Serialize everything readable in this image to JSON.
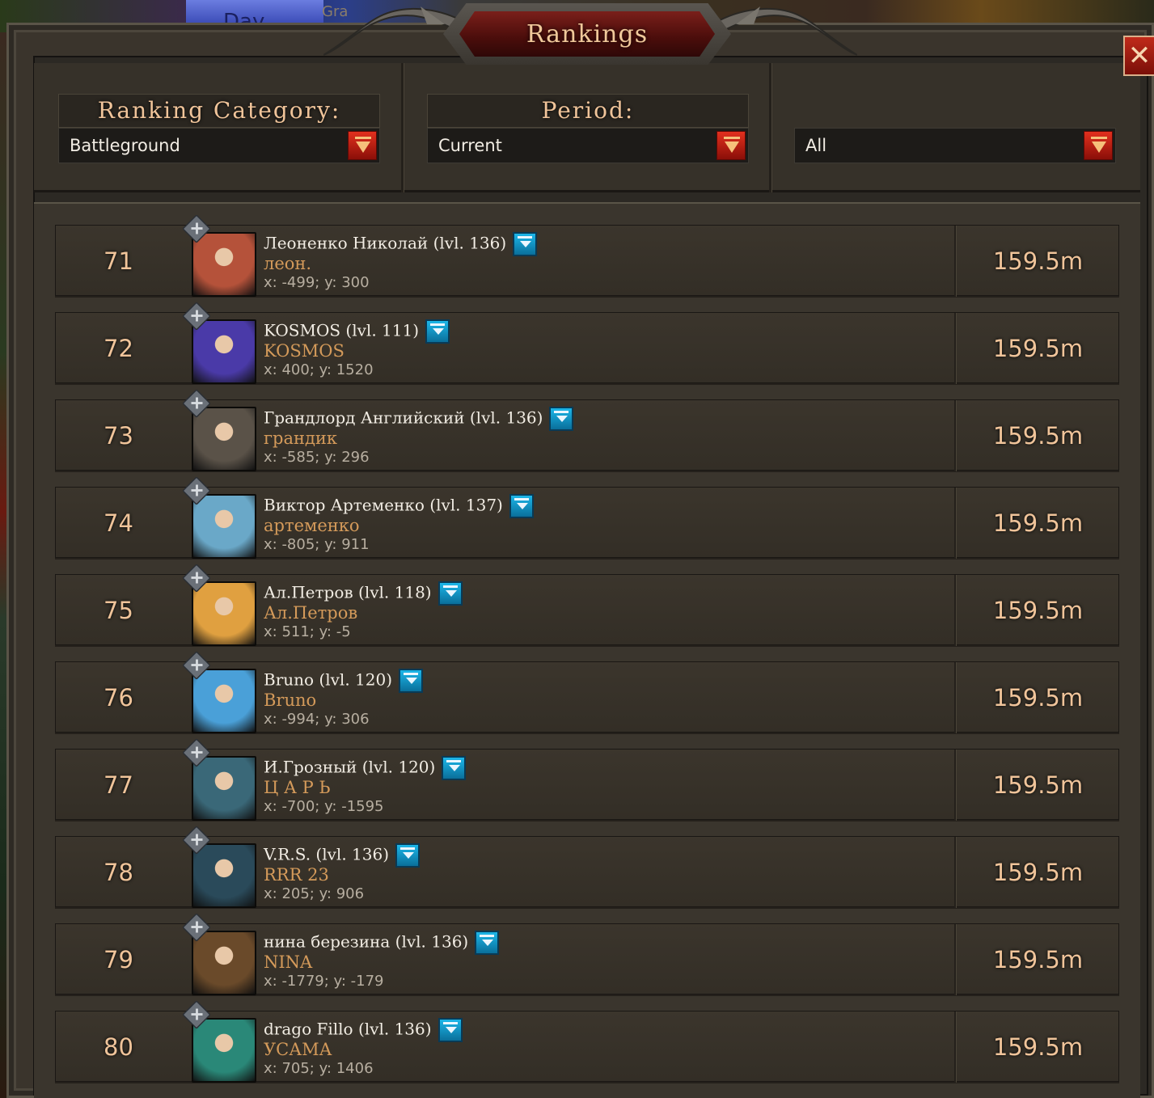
{
  "window": {
    "title": "Rankings",
    "close_icon": "close-icon"
  },
  "background": {
    "day_label": "Day",
    "partial_label": "Gra"
  },
  "filters": {
    "category": {
      "label": "Ranking Category:",
      "value": "Battleground"
    },
    "period": {
      "label": "Period:",
      "value": "Current"
    },
    "scope": {
      "value": "All"
    }
  },
  "colors": {
    "accent": "#f0c49a",
    "guild": "#d49a5a",
    "info_button": "#1cb6e8",
    "dropdown_button": "#e2301e"
  },
  "rows": [
    {
      "rank": "71",
      "name": "Леоненко Николай (lvl. 136)",
      "guild": "леон.",
      "coords": "x: -499; y: 300",
      "score": "159.5m",
      "avatar_color": "#b5523a"
    },
    {
      "rank": "72",
      "name": "KOSMOS (lvl. 111)",
      "guild": "KOSMOS",
      "coords": "x: 400; y: 1520",
      "score": "159.5m",
      "avatar_color": "#4a3aa8"
    },
    {
      "rank": "73",
      "name": "Грандлорд Английский (lvl. 136)",
      "guild": "грандик",
      "coords": "x: -585; y: 296",
      "score": "159.5m",
      "avatar_color": "#5a5248"
    },
    {
      "rank": "74",
      "name": "Виктор Артеменко (lvl. 137)",
      "guild": "артеменко",
      "coords": "x: -805; y: 911",
      "score": "159.5m",
      "avatar_color": "#6aa8c8"
    },
    {
      "rank": "75",
      "name": "Ал.Петров (lvl. 118)",
      "guild": "Ал.Петров",
      "coords": "x: 511; y: -5",
      "score": "159.5m",
      "avatar_color": "#e0a040"
    },
    {
      "rank": "76",
      "name": "Bruno (lvl. 120)",
      "guild": "Bruno",
      "coords": "x: -994; y: 306",
      "score": "159.5m",
      "avatar_color": "#4aa0d8"
    },
    {
      "rank": "77",
      "name": "И.Грозный (lvl. 120)",
      "guild": "Ц А Р Ь",
      "coords": "x: -700; y: -1595",
      "score": "159.5m",
      "avatar_color": "#3a6878"
    },
    {
      "rank": "78",
      "name": "V.R.S. (lvl. 136)",
      "guild": "RRR 23",
      "coords": "x: 205; y: 906",
      "score": "159.5m",
      "avatar_color": "#2a4a5a"
    },
    {
      "rank": "79",
      "name": "нина березина (lvl. 136)",
      "guild": "NINA",
      "coords": "x: -1779; y: -179",
      "score": "159.5m",
      "avatar_color": "#6a4a2a"
    },
    {
      "rank": "80",
      "name": "drago   Fillo (lvl. 136)",
      "guild": "УСАМА",
      "coords": "x: 705; y: 1406",
      "score": "159.5m",
      "avatar_color": "#2a8878"
    }
  ]
}
